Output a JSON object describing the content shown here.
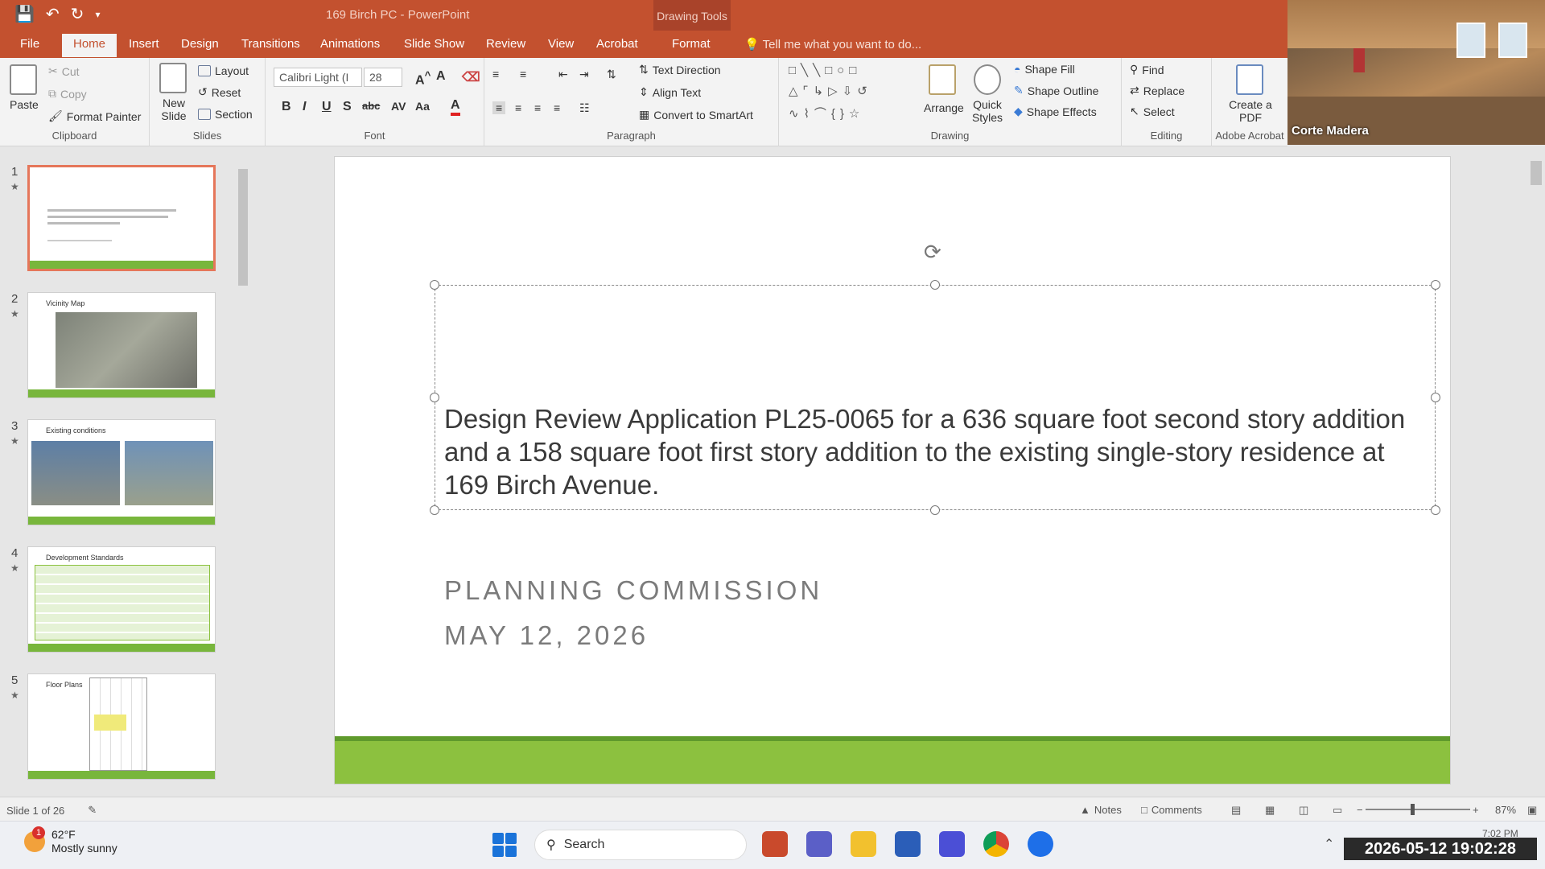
{
  "titlebar": {
    "doc_title": "169 Birch PC - PowerPoint",
    "context_group": "Drawing Tools",
    "accent": "#c3512f"
  },
  "tabs": [
    "File",
    "Home",
    "Insert",
    "Design",
    "Transitions",
    "Animations",
    "Slide Show",
    "Review",
    "View",
    "Acrobat",
    "Format"
  ],
  "tell_me": "Tell me what you want to do...",
  "ribbon": {
    "clipboard": {
      "paste": "Paste",
      "cut": "Cut",
      "copy": "Copy",
      "format_painter": "Format Painter",
      "label": "Clipboard"
    },
    "slides": {
      "new_slide": "New Slide",
      "layout": "Layout",
      "reset": "Reset",
      "section": "Section",
      "label": "Slides"
    },
    "font": {
      "font_name": "Calibri Light (I",
      "font_size": "28",
      "label": "Font"
    },
    "paragraph": {
      "text_direction": "Text Direction",
      "align_text": "Align Text",
      "convert_smartart": "Convert to SmartArt",
      "label": "Paragraph"
    },
    "drawing": {
      "arrange": "Arrange",
      "quick_styles": "Quick Styles",
      "shape_fill": "Shape Fill",
      "shape_outline": "Shape Outline",
      "shape_effects": "Shape Effects",
      "label": "Drawing"
    },
    "editing": {
      "find": "Find",
      "replace": "Replace",
      "select": "Select",
      "label": "Editing"
    },
    "acrobat": {
      "create_pdf": "Create a PDF",
      "label": "Adobe Acrobat"
    }
  },
  "video": {
    "label": "Corte Madera"
  },
  "thumbnails": [
    {
      "num": "1",
      "title": "",
      "selected": true
    },
    {
      "num": "2",
      "title": "Vicinity Map",
      "selected": false
    },
    {
      "num": "3",
      "title": "Existing conditions",
      "selected": false
    },
    {
      "num": "4",
      "title": "Development Standards",
      "selected": false
    },
    {
      "num": "5",
      "title": "Floor Plans",
      "selected": false
    }
  ],
  "slide": {
    "title": "Design Review Application PL25-0065 for a 636 square foot second story addition and a 158 square foot first story addition to the existing single-story residence at 169 Birch Avenue.",
    "subtitle1": "PLANNING COMMISSION",
    "subtitle2": "MAY 12, 2026",
    "band_color": "#8cc13f"
  },
  "status": {
    "slide_counter": "Slide 1 of 26",
    "notes": "Notes",
    "comments": "Comments",
    "zoom": "87%"
  },
  "taskbar": {
    "weather_temp": "62°F",
    "weather_desc": "Mostly sunny",
    "weather_badge": "1",
    "search": "Search",
    "small_time": "7:02 PM",
    "timestamp": "2026-05-12 19:02:28"
  }
}
